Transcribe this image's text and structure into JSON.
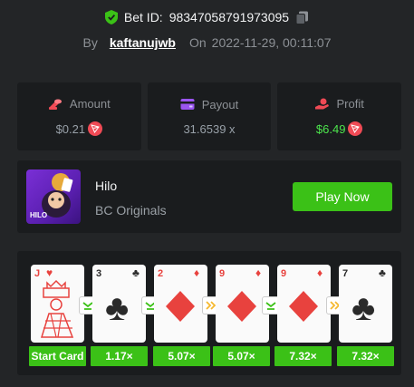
{
  "header": {
    "bet_id_label": "Bet ID:",
    "bet_id": "98347058791973095",
    "by_label": "By",
    "username": "kaftanujwb",
    "on_label": "On",
    "date": "2022-11-29, 00:11:07"
  },
  "stats": {
    "amount": {
      "label": "Amount",
      "value": "$0.21"
    },
    "payout": {
      "label": "Payout",
      "value": "31.6539 x"
    },
    "profit": {
      "label": "Profit",
      "value": "$6.49"
    }
  },
  "game": {
    "name": "Hilo",
    "provider": "BC Originals",
    "thumb_label": "HILO",
    "play_label": "Play Now"
  },
  "cards": [
    {
      "rank": "J",
      "suit": "heart",
      "color": "red",
      "label": "Start Card"
    },
    {
      "rank": "3",
      "suit": "club",
      "color": "black",
      "label": "1.17×"
    },
    {
      "rank": "2",
      "suit": "diamond",
      "color": "red",
      "label": "5.07×"
    },
    {
      "rank": "9",
      "suit": "diamond",
      "color": "red",
      "label": "5.07×"
    },
    {
      "rank": "9",
      "suit": "diamond",
      "color": "red",
      "label": "7.32×"
    },
    {
      "rank": "7",
      "suit": "club",
      "color": "black",
      "label": "7.32×"
    }
  ],
  "arrows": [
    "lower-icon",
    "lower-icon",
    "skip-icon",
    "lower-icon",
    "skip-icon"
  ],
  "colors": {
    "accent_green": "#3bc117",
    "profit_green": "#4de64d",
    "trx_red": "#f04a55",
    "bg": "#232527",
    "panel": "#1a1c1e"
  }
}
